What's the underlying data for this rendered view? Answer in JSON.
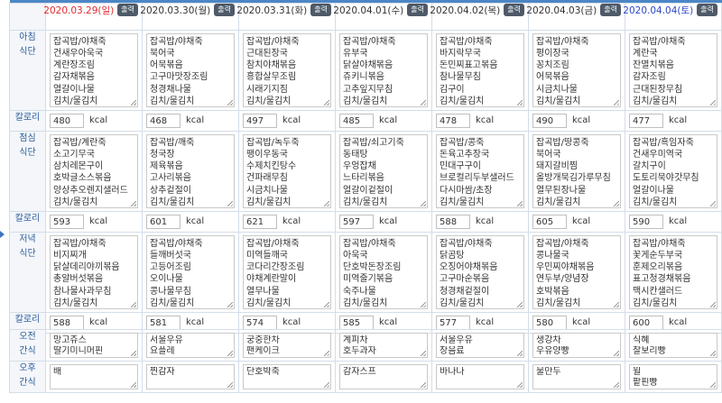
{
  "days": [
    {
      "date": "2020.03.29(일)",
      "kind": "sun",
      "breakfast": [
        "잡곡밥/야채죽",
        "건새우아욱국",
        "계란장조림",
        "감자채볶음",
        "열갈이나물",
        "김치/물김치"
      ],
      "breakfast_kcal": "480",
      "lunch": [
        "잡곡밥/계란죽",
        "소고기무국",
        "삼치레몬구이",
        "호박글소스볶음",
        "양상추오렌지샐러드",
        "김치/물김치"
      ],
      "lunch_kcal": "593",
      "dinner": [
        "잡곡밥/야채죽",
        "비지찌개",
        "닭살데리야끼볶음",
        "총알버섯볶음",
        "참나물사과무침",
        "김치/물김치"
      ],
      "dinner_kcal": "588",
      "am_snack": [
        "망고쥬스",
        "딸기미니머핀"
      ],
      "pm_snack": [
        "배"
      ]
    },
    {
      "date": "2020.03.30(월)",
      "kind": "weekday",
      "breakfast": [
        "잡곡밥/야채죽",
        "북어국",
        "어묵볶음",
        "고구마맛장조림",
        "청경채나물",
        "김치/물김치"
      ],
      "breakfast_kcal": "468",
      "lunch": [
        "잡곡밥/깨죽",
        "청국장",
        "제육볶음",
        "고사리볶음",
        "상추겉절이",
        "김치/물김치"
      ],
      "lunch_kcal": "601",
      "dinner": [
        "잡곡밥/야채죽",
        "들깨버섯국",
        "고등어조림",
        "오이나물",
        "콩나물무침",
        "김치/물김치"
      ],
      "dinner_kcal": "581",
      "am_snack": [
        "서울우유",
        "요플레"
      ],
      "pm_snack": [
        "찐감자"
      ]
    },
    {
      "date": "2020.03.31(화)",
      "kind": "weekday",
      "breakfast": [
        "잡곡밥/야채죽",
        "근대된장국",
        "참치야채볶음",
        "흥합살무조림",
        "시래기지짐",
        "김치/물김치"
      ],
      "breakfast_kcal": "497",
      "lunch": [
        "잡곡밥/녹두죽",
        "팽이우동국",
        "수제치킨탕수",
        "건파래무침",
        "시금치나물",
        "김치/물김치"
      ],
      "lunch_kcal": "621",
      "dinner": [
        "잡곡밥/야채죽",
        "미역들깨국",
        "코다리간장조림",
        "야채계란말이",
        "열무나물",
        "김치/물김치"
      ],
      "dinner_kcal": "574",
      "am_snack": [
        "궁중한차",
        "팬케이크"
      ],
      "pm_snack": [
        "단호박죽"
      ]
    },
    {
      "date": "2020.04.01(수)",
      "kind": "weekday",
      "breakfast": [
        "잡곡밥/야채죽",
        "유부국",
        "닭살야채볶음",
        "쥬키니볶음",
        "고추잎지무침",
        "김치/물김치"
      ],
      "breakfast_kcal": "485",
      "lunch": [
        "잡곡밥/쇠고기죽",
        "동태탕",
        "우엉잡채",
        "느타리볶음",
        "얼갈이겉절이",
        "김치/물김치"
      ],
      "lunch_kcal": "597",
      "dinner": [
        "잡곡밥/야채죽",
        "아욱국",
        "단호박돈장조림",
        "미역줄기볶음",
        "숙주나물",
        "김치/물김치"
      ],
      "dinner_kcal": "585",
      "am_snack": [
        "계피차",
        "호두과자"
      ],
      "pm_snack": [
        "감자스프"
      ]
    },
    {
      "date": "2020.04.02(목)",
      "kind": "weekday",
      "breakfast": [
        "잡곡밥/야채죽",
        "바지락무국",
        "돈민찌표고볶음",
        "참나물무침",
        "김구이",
        "김치/물김치"
      ],
      "breakfast_kcal": "478",
      "lunch": [
        "잡곡밥/콩죽",
        "돈육고추장국",
        "민대구구이",
        "브로컬리두부샐러드",
        "다시마쌈/초장",
        "김치/물김치"
      ],
      "lunch_kcal": "588",
      "dinner": [
        "잡곡밥/야채죽",
        "닭곰탕",
        "오징어야채볶음",
        "고구마순볶음",
        "청경채겉절이",
        "김치/물김치"
      ],
      "dinner_kcal": "577",
      "am_snack": [
        "서울우유",
        "장음료"
      ],
      "pm_snack": [
        "바나나"
      ]
    },
    {
      "date": "2020.04.03(금)",
      "kind": "weekday",
      "breakfast": [
        "잡곡밥/야채죽",
        "평이장국",
        "꽁치조림",
        "어묵볶음",
        "시금치나물",
        "김치/물김치"
      ],
      "breakfast_kcal": "490",
      "lunch": [
        "잡곡밥/땅콩죽",
        "북어국",
        "돼지갈비찜",
        "올방개묵김가루무침",
        "열무된장나물",
        "김치/물김치"
      ],
      "lunch_kcal": "605",
      "dinner": [
        "잡곡밥/야채죽",
        "콩나물국",
        "우민찌야채볶음",
        "연두부/양념장",
        "호박볶음",
        "김치/물김치"
      ],
      "dinner_kcal": "580",
      "am_snack": [
        "생강차",
        "우유양빵"
      ],
      "pm_snack": [
        "물만두"
      ]
    },
    {
      "date": "2020.04.04(토)",
      "kind": "sat",
      "breakfast": [
        "잡곡밥/야채죽",
        "계란국",
        "잔멸치볶음",
        "감자조림",
        "근대된장무침",
        "김치/물김치"
      ],
      "breakfast_kcal": "477",
      "lunch": [
        "잡곡밥/흑임자죽",
        "건새우미역국",
        "갈치구이",
        "도토리묵야갓무침",
        "얼갈이나물",
        "김치/물김치"
      ],
      "lunch_kcal": "590",
      "dinner": [
        "잡곡밥/야채죽",
        "꽃게순두부국",
        "훈제오리볶음",
        "표고청경채볶음",
        "맥시칸샐러드",
        "김치/물김치"
      ],
      "dinner_kcal": "600",
      "am_snack": [
        "식혜",
        "찰보리빵"
      ],
      "pm_snack": [
        "윌",
        "팥핀빵"
      ]
    }
  ],
  "labels": {
    "print": "출력",
    "kcal_unit": "kcal",
    "calorie": "칼로리",
    "breakfast_1": "아침",
    "breakfast_2": "식단",
    "lunch_1": "점심",
    "lunch_2": "식단",
    "dinner_1": "저녁",
    "dinner_2": "식단",
    "am_snack_1": "오전",
    "am_snack_2": "간식",
    "pm_snack_1": "오후",
    "pm_snack_2": "간식"
  }
}
